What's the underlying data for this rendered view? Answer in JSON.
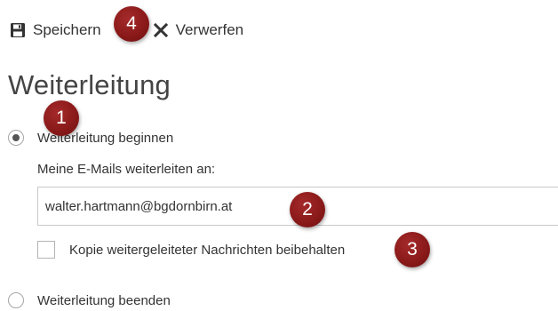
{
  "toolbar": {
    "save_label": "Speichern",
    "discard_label": "Verwerfen",
    "save_icon": "floppy-disk-icon",
    "discard_icon": "close-icon"
  },
  "page": {
    "title": "Weiterleitung"
  },
  "forwarding": {
    "start_label": "Weiterleitung beginnen",
    "start_selected": true,
    "forward_to_label": "Meine E-Mails weiterleiten an:",
    "email_value": "walter.hartmann@bgdornbirn.at",
    "keep_copy_label": "Kopie weitergeleiteter Nachrichten beibehalten",
    "keep_copy_checked": false,
    "stop_label": "Weiterleitung beenden",
    "stop_selected": false
  },
  "annotations": {
    "badge_1": "1",
    "badge_2": "2",
    "badge_3": "3",
    "badge_4": "4",
    "color": "#8b1a1a"
  }
}
